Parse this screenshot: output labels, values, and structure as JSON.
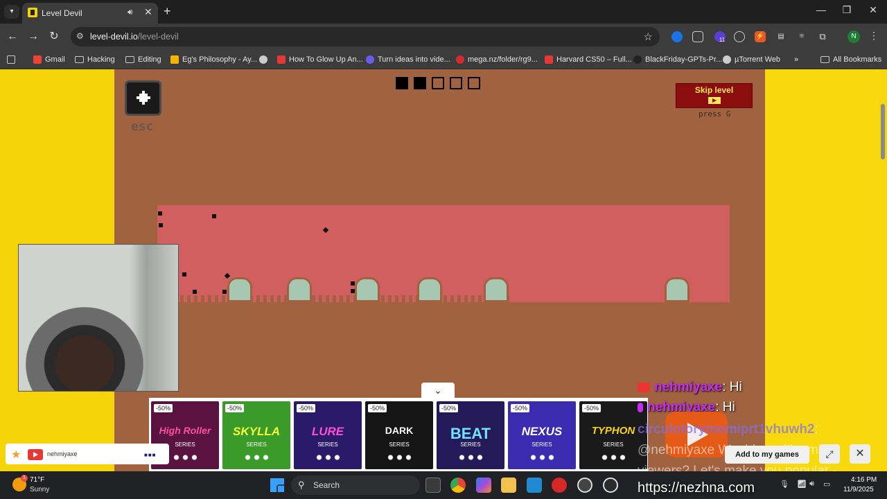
{
  "browser": {
    "tab_title": "Level Devil",
    "url_host": "level-devil.io",
    "url_path": "/level-devil",
    "extension_badge": "11",
    "profile_initial": "N"
  },
  "bookmarks": [
    {
      "label": "Gmail",
      "icon": "gmail-icon",
      "color": "#ea4335"
    },
    {
      "label": "Hacking",
      "icon": "folder-icon"
    },
    {
      "label": "Editing",
      "icon": "folder-icon"
    },
    {
      "label": "Eg's Philosophy - Ay...",
      "icon": "doc-icon",
      "color": "#f4b400"
    },
    {
      "label": "",
      "icon": "globe-icon",
      "color": "#cccccc"
    },
    {
      "label": "How To Glow Up An...",
      "icon": "youtube-icon",
      "color": "#e53935"
    },
    {
      "label": "Turn ideas into vide...",
      "icon": "ai-icon",
      "color": "#6b5bf0"
    },
    {
      "label": "mega.nz/folder/rg9...",
      "icon": "mega-icon",
      "color": "#d9272e"
    },
    {
      "label": "Harvard CS50 – Full...",
      "icon": "youtube-icon",
      "color": "#e53935"
    },
    {
      "label": "BlackFriday-GPTs-Pr...",
      "icon": "github-icon",
      "color": "#222222"
    },
    {
      "label": "µTorrent Web",
      "icon": "globe-icon",
      "color": "#cccccc"
    }
  ],
  "all_bookmarks_label": "All Bookmarks",
  "game": {
    "esc_label": "esc",
    "progress": {
      "total": 5,
      "completed": 2
    },
    "skip_label": "Skip level",
    "skip_hint": "press G"
  },
  "ads": [
    {
      "badge": "-50%",
      "title": "High Roller",
      "sub": "SERIES",
      "bg": "#5a1340",
      "color": "#ff4fa3"
    },
    {
      "badge": "-50%",
      "title": "SKYLLA",
      "sub": "SERIES",
      "bg": "#3a9a2a",
      "color": "#f6ff3a"
    },
    {
      "badge": "-50%",
      "title": "LURE",
      "sub": "SERIES",
      "bg": "#2a1a6a",
      "color": "#ff4fd8"
    },
    {
      "badge": "-50%",
      "title": "DARK",
      "sub": "SERIES",
      "bg": "#151515",
      "color": "#ffffff"
    },
    {
      "badge": "-50%",
      "title": "BEAT",
      "sub": "SERIES",
      "bg": "#241a5a",
      "color": "#6fe3ff"
    },
    {
      "badge": "-50%",
      "title": "NEXUS",
      "sub": "SERIES",
      "bg": "#3b2bb0",
      "color": "#ffffff"
    },
    {
      "badge": "-50%",
      "title": "TYPHON",
      "sub": "SERIES",
      "bg": "#1a1a1a",
      "color": "#f9d21a"
    }
  ],
  "stream_widget": {
    "channel": "nehmiyaxe"
  },
  "chat": [
    {
      "user": "nehmiyaxe",
      "message": ": Hi"
    },
    {
      "user": "nehmiyaxe",
      "message": ": Hi"
    }
  ],
  "chat_bot": {
    "user": "circulotorymomiprt1vhuwh2",
    "message": ": @nehmiyaxe Would you like many viewers? Let's make you popular -"
  },
  "chat_url": "https://nezhna.com",
  "add_games_label": "Add to my games",
  "taskbar": {
    "weather_temp": "71°F",
    "weather_cond": "Sunny",
    "weather_badge": "1",
    "search_label": "Search",
    "time": "4:16 PM",
    "date": "11/9/2025"
  }
}
